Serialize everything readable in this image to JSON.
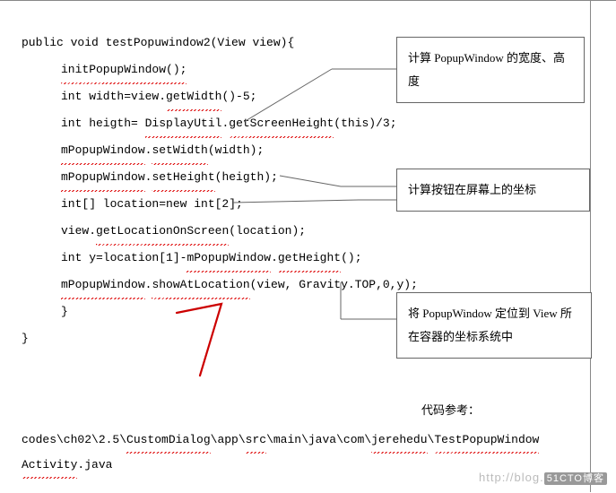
{
  "code": {
    "l0": "public void testPopuwindow2(View view){",
    "l1": "initPopupWindow();",
    "l2_a": "int width=view.",
    "l2_b": "getWidth",
    "l2_c": "()-5;",
    "l3_a": "int heigth= ",
    "l3_b": "DisplayUtil",
    "l3_c": ".",
    "l3_d": "getScreenHeight",
    "l3_e": "(this)/3;",
    "l4_a": "mPopupWindow",
    "l4_b": ".",
    "l4_c": "setWidth",
    "l4_d": "(width);",
    "l5_a": "mPopupWindow",
    "l5_b": ".",
    "l5_c": "setHeight",
    "l5_d": "(heigth);",
    "l6": "int[] location=new int[2];",
    "l7_a": "view.",
    "l7_b": "getLocationOnScreen",
    "l7_c": "(location);",
    "l8_a": "int y=location[1]-",
    "l8_b": "mPopupWindow",
    "l8_c": ".",
    "l8_d": "getHeight",
    "l8_e": "();",
    "l9_a": "mPopupWindow",
    "l9_b": ".",
    "l9_c": "showAtLocation",
    "l9_d": "(view, Gravity.TOP,0,y);",
    "brace1": "}",
    "brace0": "}"
  },
  "callouts": {
    "c1": "计算 PopupWindow 的宽度、高度",
    "c2": "计算按钮在屏幕上的坐标",
    "c3": "将 PopupWindow 定位到 View 所在容器的坐标系统中",
    "ref": "代码参考："
  },
  "bottom": {
    "p1": "codes\\ch02\\2.5\\",
    "p2": "CustomDialog",
    "p3": "\\app\\",
    "p4": "src",
    "p5": "\\main\\java\\com\\",
    "p6": "jerehedu",
    "p7": "\\",
    "p8": "TestPopupWindow",
    "q1": "Activity",
    "q2": ".java"
  },
  "watermark": {
    "prefix": "http://blog.",
    "badge": "51CTO博客"
  }
}
